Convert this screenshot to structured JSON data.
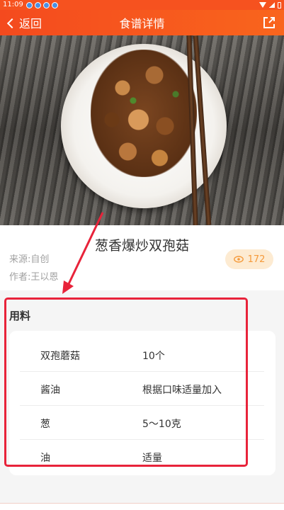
{
  "status_bar": {
    "time": "11:09"
  },
  "nav": {
    "back_label": "返回",
    "title": "食谱详情"
  },
  "recipe": {
    "title": "葱香爆炒双孢菇",
    "source": "来源:自创",
    "author": "作者:王以恩",
    "views": "172"
  },
  "ingredients": {
    "section_title": "用料",
    "items": [
      {
        "name": "双孢蘑菇",
        "amount": "10个"
      },
      {
        "name": "酱油",
        "amount": "根据口味适量加入"
      },
      {
        "name": "葱",
        "amount": "5～10克"
      },
      {
        "name": "油",
        "amount": "适量"
      }
    ]
  },
  "colors": {
    "header": "#f6521f",
    "highlight": "#e8233a",
    "views_badge_bg": "#fdebd2",
    "views_badge_text": "#f59a3b"
  },
  "icons": {
    "back": "chevron-left-icon",
    "share": "share-icon",
    "views": "eye-icon"
  }
}
